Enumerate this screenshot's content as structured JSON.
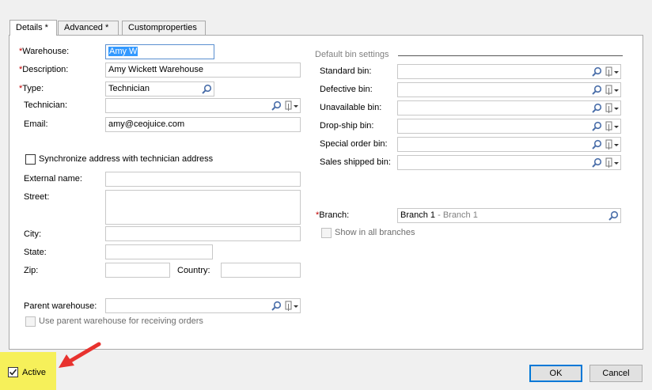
{
  "tabs": [
    {
      "label": "Details *"
    },
    {
      "label": "Advanced *"
    },
    {
      "label": "Customproperties"
    }
  ],
  "left": {
    "warehouse": {
      "label": "Warehouse:",
      "value": "Amy W"
    },
    "description": {
      "label": "Description:",
      "value": "Amy Wickett Warehouse"
    },
    "type": {
      "label": "Type:",
      "value": "Technician"
    },
    "technician": {
      "label": "Technician:",
      "value": ""
    },
    "email": {
      "label": "Email:",
      "value": "amy@ceojuice.com"
    },
    "sync_address": {
      "label": "Synchronize address with technician address",
      "checked": false
    },
    "external_name": {
      "label": "External name:",
      "value": ""
    },
    "street": {
      "label": "Street:",
      "value": ""
    },
    "city": {
      "label": "City:",
      "value": ""
    },
    "state": {
      "label": "State:",
      "value": ""
    },
    "zip": {
      "label": "Zip:",
      "value": ""
    },
    "country": {
      "label": "Country:",
      "value": ""
    },
    "parent_warehouse": {
      "label": "Parent warehouse:",
      "value": ""
    },
    "use_parent": {
      "label": "Use parent warehouse for receiving orders",
      "checked": false,
      "disabled": true
    }
  },
  "right": {
    "section_title": "Default bin settings",
    "bins": [
      {
        "label": "Standard bin:",
        "value": ""
      },
      {
        "label": "Defective bin:",
        "value": ""
      },
      {
        "label": "Unavailable bin:",
        "value": ""
      },
      {
        "label": "Drop-ship bin:",
        "value": ""
      },
      {
        "label": "Special order bin:",
        "value": ""
      },
      {
        "label": "Sales shipped bin:",
        "value": ""
      }
    ],
    "branch": {
      "label": "Branch:",
      "value": "Branch 1",
      "secondary": "- Branch 1"
    },
    "show_all_branches": {
      "label": "Show in all branches",
      "checked": false,
      "disabled": true
    }
  },
  "footer": {
    "active": {
      "label": "Active",
      "checked": true
    },
    "ok_label": "OK",
    "cancel_label": "Cancel"
  },
  "required_marker": "*",
  "colors": {
    "required": "#c00000",
    "annotation_arrow": "#e8322e",
    "highlight": "#f6f05a",
    "selection": "#3399ff"
  }
}
